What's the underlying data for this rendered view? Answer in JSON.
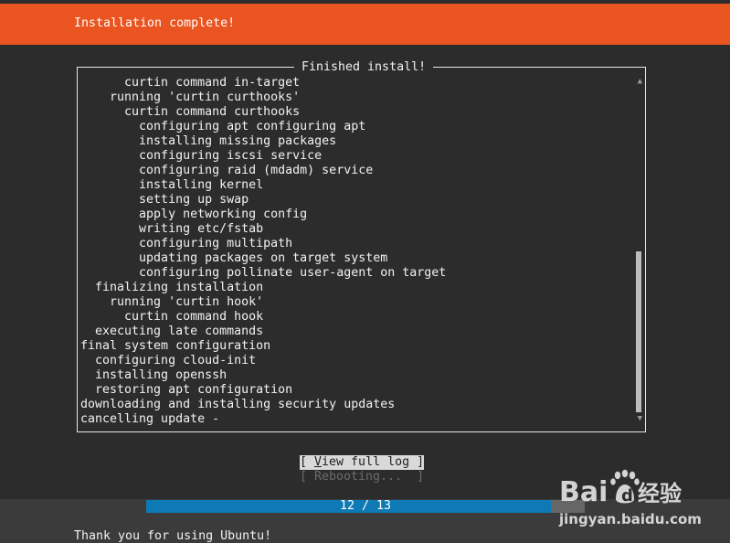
{
  "header": {
    "title": "Installation complete!"
  },
  "log": {
    "frame_title": "Finished install!",
    "lines": [
      {
        "indent": 6,
        "text": "curtin command in-target"
      },
      {
        "indent": 4,
        "text": "running 'curtin curthooks'"
      },
      {
        "indent": 6,
        "text": "curtin command curthooks"
      },
      {
        "indent": 8,
        "text": "configuring apt configuring apt"
      },
      {
        "indent": 8,
        "text": "installing missing packages"
      },
      {
        "indent": 8,
        "text": "configuring iscsi service"
      },
      {
        "indent": 8,
        "text": "configuring raid (mdadm) service"
      },
      {
        "indent": 8,
        "text": "installing kernel"
      },
      {
        "indent": 8,
        "text": "setting up swap"
      },
      {
        "indent": 8,
        "text": "apply networking config"
      },
      {
        "indent": 8,
        "text": "writing etc/fstab"
      },
      {
        "indent": 8,
        "text": "configuring multipath"
      },
      {
        "indent": 8,
        "text": "updating packages on target system"
      },
      {
        "indent": 8,
        "text": "configuring pollinate user-agent on target"
      },
      {
        "indent": 2,
        "text": "finalizing installation"
      },
      {
        "indent": 4,
        "text": "running 'curtin hook'"
      },
      {
        "indent": 6,
        "text": "curtin command hook"
      },
      {
        "indent": 2,
        "text": "executing late commands"
      },
      {
        "indent": 0,
        "text": "final system configuration"
      },
      {
        "indent": 2,
        "text": "configuring cloud-init"
      },
      {
        "indent": 2,
        "text": "installing openssh"
      },
      {
        "indent": 2,
        "text": "restoring apt configuration"
      },
      {
        "indent": 0,
        "text": "downloading and installing security updates"
      },
      {
        "indent": 0,
        "text": "cancelling update -"
      }
    ],
    "scroll_up_icon": "triangle-up-icon",
    "scroll_down_icon": "triangle-down-icon"
  },
  "buttons": {
    "view_log_open": "[ ",
    "view_log_hotkey": "V",
    "view_log_rest": "iew full log ]",
    "reboot": "[ Rebooting...  ]"
  },
  "progress": {
    "text": "12 / 13",
    "current": 12,
    "total": 13
  },
  "footer": {
    "text": "Thank you for using Ubuntu!"
  },
  "watermark": {
    "logo_text": "Bai du 经验",
    "url": "jingyan.baidu.com"
  },
  "colors": {
    "header": "#e95420",
    "background": "#2c2c2c",
    "progress_fill": "#0e7ab5",
    "progress_track": "#666666"
  }
}
